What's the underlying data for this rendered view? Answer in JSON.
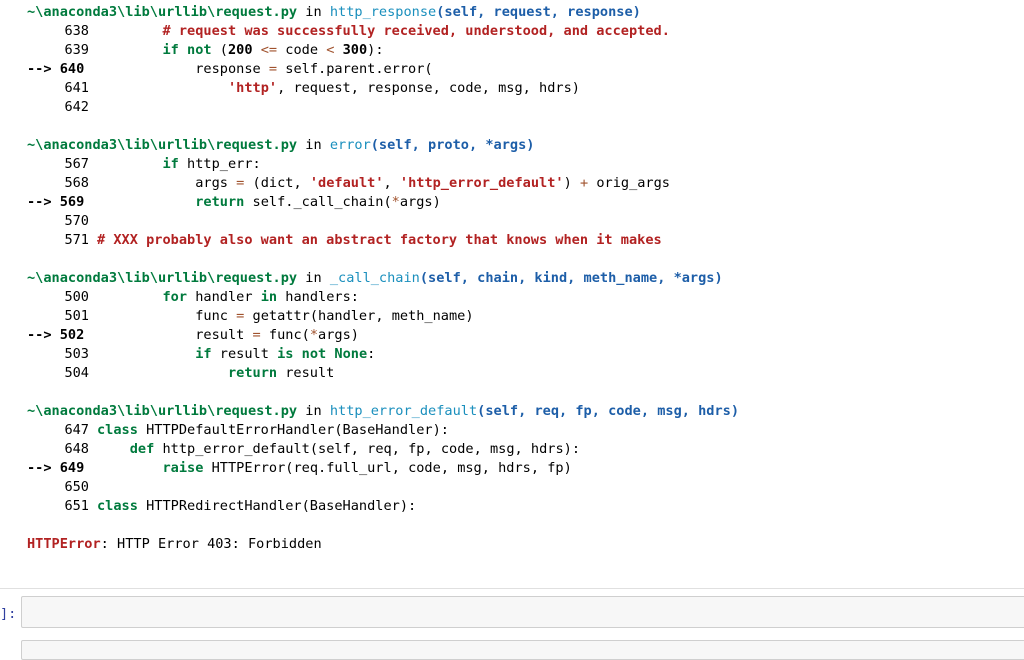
{
  "traceback": {
    "frames": [
      {
        "path": "~\\anaconda3\\lib\\urllib\\request.py",
        "in_word": " in ",
        "func": "http_response",
        "args": "(self, request, response)",
        "lines": [
          {
            "num": "638",
            "code": "        # request was successfully received, understood, and accepted."
          },
          {
            "num": "639",
            "code": "        if not (200 <= code < 300):"
          },
          {
            "num": "--> 640",
            "code": "            response = self.parent.error("
          },
          {
            "num": "641",
            "code": "                'http', request, response, code, msg, hdrs)"
          },
          {
            "num": "642",
            "code": ""
          }
        ]
      },
      {
        "path": "~\\anaconda3\\lib\\urllib\\request.py",
        "in_word": " in ",
        "func": "error",
        "args": "(self, proto, *args)",
        "lines": [
          {
            "num": "567",
            "code": "        if http_err:"
          },
          {
            "num": "568",
            "code": "            args = (dict, 'default', 'http_error_default') + orig_args"
          },
          {
            "num": "--> 569",
            "code": "            return self._call_chain(*args)"
          },
          {
            "num": "570",
            "code": ""
          },
          {
            "num": "571",
            "code": "# XXX probably also want an abstract factory that knows when it makes"
          }
        ]
      },
      {
        "path": "~\\anaconda3\\lib\\urllib\\request.py",
        "in_word": " in ",
        "func": "_call_chain",
        "args": "(self, chain, kind, meth_name, *args)",
        "lines": [
          {
            "num": "500",
            "code": "        for handler in handlers:"
          },
          {
            "num": "501",
            "code": "            func = getattr(handler, meth_name)"
          },
          {
            "num": "--> 502",
            "code": "            result = func(*args)"
          },
          {
            "num": "503",
            "code": "            if result is not None:"
          },
          {
            "num": "504",
            "code": "                return result"
          }
        ]
      },
      {
        "path": "~\\anaconda3\\lib\\urllib\\request.py",
        "in_word": " in ",
        "func": "http_error_default",
        "args": "(self, req, fp, code, msg, hdrs)",
        "lines": [
          {
            "num": "647",
            "code": "class HTTPDefaultErrorHandler(BaseHandler):"
          },
          {
            "num": "648",
            "code": "    def http_error_default(self, req, fp, code, msg, hdrs):"
          },
          {
            "num": "--> 649",
            "code": "        raise HTTPError(req.full_url, code, msg, hdrs, fp)"
          },
          {
            "num": "650",
            "code": ""
          },
          {
            "num": "651",
            "code": "class HTTPRedirectHandler(BaseHandler):"
          }
        ]
      }
    ],
    "error": {
      "name": "HTTPError",
      "message": ": HTTP Error 403: Forbidden"
    }
  },
  "cell": {
    "prompt": "]:"
  },
  "colors": {
    "path": "#007a3d",
    "func": "#1a8fbd",
    "args": "#1d5ea8",
    "comment": "#b22222",
    "error": "#b22222"
  }
}
